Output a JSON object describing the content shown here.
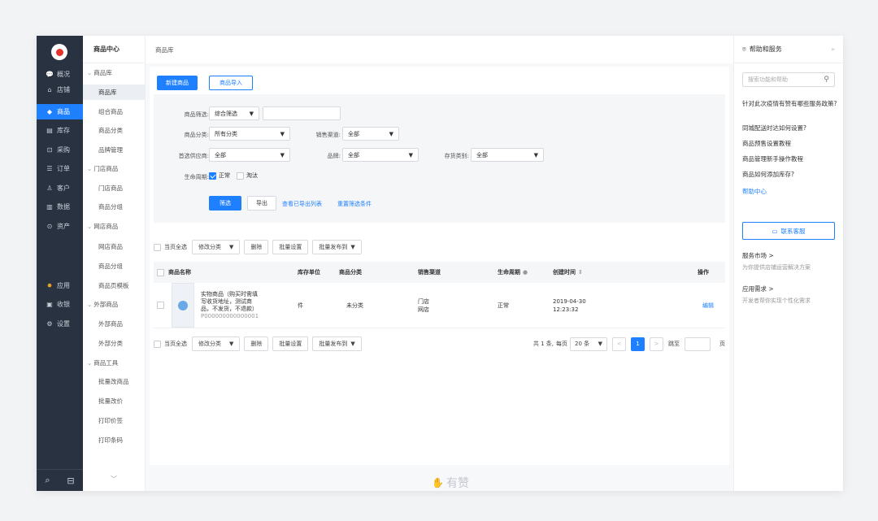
{
  "rail": {
    "items": [
      {
        "icon": "💬",
        "label": "概况",
        "icon_name": "chat-icon"
      },
      {
        "icon": "⌂",
        "label": "店铺",
        "icon_name": "store-icon"
      },
      {
        "icon": "◆",
        "label": "商品",
        "icon_name": "tag-icon",
        "active": true
      },
      {
        "icon": "▤",
        "label": "库存",
        "icon_name": "inventory-icon"
      },
      {
        "icon": "⊡",
        "label": "采购",
        "icon_name": "purchase-icon"
      },
      {
        "icon": "☰",
        "label": "订单",
        "icon_name": "order-icon"
      },
      {
        "icon": "♙",
        "label": "客户",
        "icon_name": "customer-icon"
      },
      {
        "icon": "▥",
        "label": "数据",
        "icon_name": "chart-icon"
      },
      {
        "icon": "⊙",
        "label": "资产",
        "icon_name": "asset-icon"
      },
      {
        "icon": "✸",
        "label": "应用",
        "icon_name": "apps-icon"
      },
      {
        "icon": "▣",
        "label": "收银",
        "icon_name": "cashier-icon"
      },
      {
        "icon": "⚙",
        "label": "设置",
        "icon_name": "gear-icon"
      }
    ],
    "bottom_search": "⌕",
    "bottom_msg": "⊟"
  },
  "sub": {
    "title": "商品中心",
    "groups": [
      {
        "label": "商品库",
        "items": [
          "商品库",
          "组合商品",
          "商品分类",
          "品牌管理"
        ]
      },
      {
        "label": "门店商品",
        "items": [
          "门店商品",
          "商品分组"
        ]
      },
      {
        "label": "网店商品",
        "items": [
          "网店商品",
          "商品分组",
          "商品页模板"
        ]
      },
      {
        "label": "外部商品",
        "items": [
          "外部商品",
          "外部分类"
        ]
      },
      {
        "label": "商品工具",
        "items": [
          "批量改商品",
          "批量改价",
          "打印价签",
          "打印条码"
        ]
      }
    ],
    "chevron": "﹀"
  },
  "main": {
    "breadcrumb": "商品库",
    "new_button": "新建商品",
    "import_button": "商品导入",
    "filter": {
      "product_filter_label": "商品筛选:",
      "product_filter_value": "综合筛选",
      "category_label": "商品分类:",
      "category_value": "所有分类",
      "channel_label": "销售渠道:",
      "channel_value": "全部",
      "supplier_label": "首选供应商:",
      "supplier_value": "全部",
      "brand_label": "品牌:",
      "brand_value": "全部",
      "stock_label": "存货类别:",
      "stock_value": "全部",
      "lifecycle_label": "生命周期:",
      "lifecycle_normal": "正常",
      "lifecycle_obsolete": "淘汰",
      "filter_button": "筛选",
      "export_button": "导出",
      "view_exports_link": "查看已导出列表",
      "reset_link": "重置筛选条件"
    },
    "bulk": {
      "select_all": "当页全选",
      "modify_category": "修改分类",
      "delete": "删除",
      "batch_settings": "批量设置",
      "batch_publish": "批量发布到"
    },
    "table": {
      "headers": {
        "name": "商品名称",
        "unit": "库存单位",
        "category": "商品分类",
        "channel": "销售渠道",
        "lifecycle": "生命周期",
        "created": "创建时间",
        "sort_icon": "⇕",
        "action": "操作"
      },
      "rows": [
        {
          "name_line1": "实物商品（购买时需填",
          "name_line2": "写收货地址，测试商",
          "name_line3": "品，不发货，不退款）",
          "code": "P000000000000001",
          "unit": "件",
          "category": "未分类",
          "channel_line1": "门店",
          "channel_line2": "网店",
          "lifecycle": "正常",
          "created_date": "2019-04-30",
          "created_time": "12:23:32",
          "action": "编辑"
        }
      ]
    },
    "pager": {
      "total": "共 1 条,",
      "per_page_label": "每页",
      "per_page_value": "20 条",
      "current_page": "1",
      "jump_label": "跳至",
      "page_suffix": "页"
    },
    "watermark": "有赞",
    "caret": "▼",
    "prev": "<",
    "next": ">"
  },
  "help": {
    "title": "帮助和服务",
    "collapse": "»",
    "search_placeholder": "搜索功能和帮助",
    "questions": [
      "针对此次疫情有赞有哪些服务政策?",
      "同城配送时达如何设置?",
      "商品预售设置教程",
      "商品管理新手操作教程",
      "商品如何添加库存?"
    ],
    "help_center": "帮助中心",
    "contact": "联系客服",
    "service_market": "服务市场 >",
    "service_market_desc": "为你提供店铺运营解决方案",
    "app_request": "应用需求 >",
    "app_request_desc": "开发者帮你实现个性化需求"
  }
}
